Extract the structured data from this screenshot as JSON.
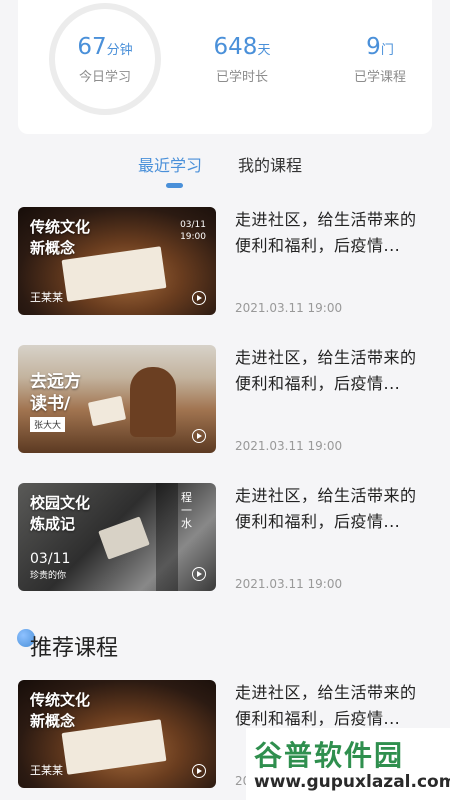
{
  "stats": [
    {
      "value": "67",
      "unit": "分钟",
      "label": "今日学习"
    },
    {
      "value": "648",
      "unit": "天",
      "label": "已学时长"
    },
    {
      "value": "9",
      "unit": "门",
      "label": "已学课程"
    }
  ],
  "tabs": {
    "recent": "最近学习",
    "mine": "我的课程"
  },
  "courses": [
    {
      "thumb_title_1": "传统文化",
      "thumb_title_2": "新概念",
      "thumb_author": "王某某",
      "thumb_date_1": "03/11",
      "thumb_date_2": "19:00",
      "desc_1": "走进社区，给生活带来的",
      "desc_2": "便利和福利，后疫情...",
      "time": "2021.03.11 19:00"
    },
    {
      "thumb_title_1": "去远方",
      "thumb_title_2": "读书/",
      "thumb_author": "张大大",
      "desc_1": "走进社区，给生活带来的",
      "desc_2": "便利和福利，后疫情...",
      "time": "2021.03.11 19:00"
    },
    {
      "thumb_title_1": "校园文化",
      "thumb_title_2": "炼成记",
      "thumb_author": "珍贵的你",
      "thumb_big": "03/11",
      "thumb_side_1": "程",
      "thumb_side_2": "一",
      "thumb_side_3": "水",
      "desc_1": "走进社区，给生活带来的",
      "desc_2": "便利和福利，后疫情...",
      "time": "2021.03.11 19:00"
    },
    {
      "thumb_title_1": "传统文化",
      "thumb_title_2": "新概念",
      "thumb_author": "王某某",
      "desc_1": "走进社区，给生活带来的",
      "desc_2": "便利和福利，后疫情...",
      "time": "20"
    }
  ],
  "section": {
    "recommended": "推荐课程"
  },
  "watermark": {
    "main": "谷普软件园",
    "url": "www.gupuxlazal.com"
  },
  "colors": {
    "accent": "#4a90d9",
    "watermark": "#2f8f4e"
  }
}
